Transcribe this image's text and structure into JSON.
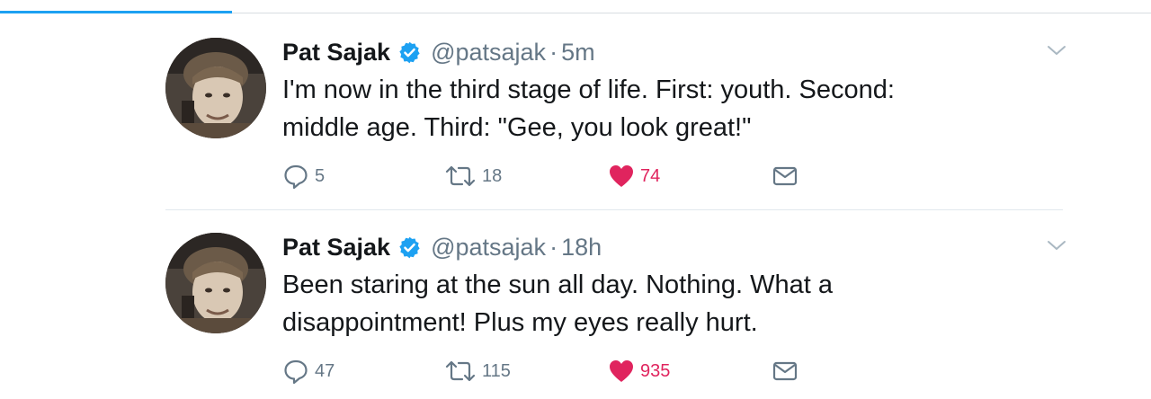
{
  "colors": {
    "accent": "#1da1f2",
    "like": "#e0245e",
    "secondary_text": "#657786",
    "primary_text": "#14171a"
  },
  "tweets": [
    {
      "name": "Pat Sajak",
      "handle": "@patsajak",
      "separator": "·",
      "time": "5m",
      "verified": true,
      "text": "I'm now in the third stage of life. First: youth. Second: middle age. Third: \"Gee, you look great!\"",
      "replies": "5",
      "retweets": "18",
      "likes": "74",
      "liked": true
    },
    {
      "name": "Pat Sajak",
      "handle": "@patsajak",
      "separator": "·",
      "time": "18h",
      "verified": true,
      "text": "Been staring at the sun all day. Nothing. What a disappointment! Plus my eyes really hurt.",
      "replies": "47",
      "retweets": "115",
      "likes": "935",
      "liked": true
    }
  ],
  "icons": {
    "verified": "verified-badge-icon",
    "caret": "chevron-down-icon",
    "reply": "reply-icon",
    "retweet": "retweet-icon",
    "like": "heart-icon",
    "dm": "envelope-icon"
  }
}
